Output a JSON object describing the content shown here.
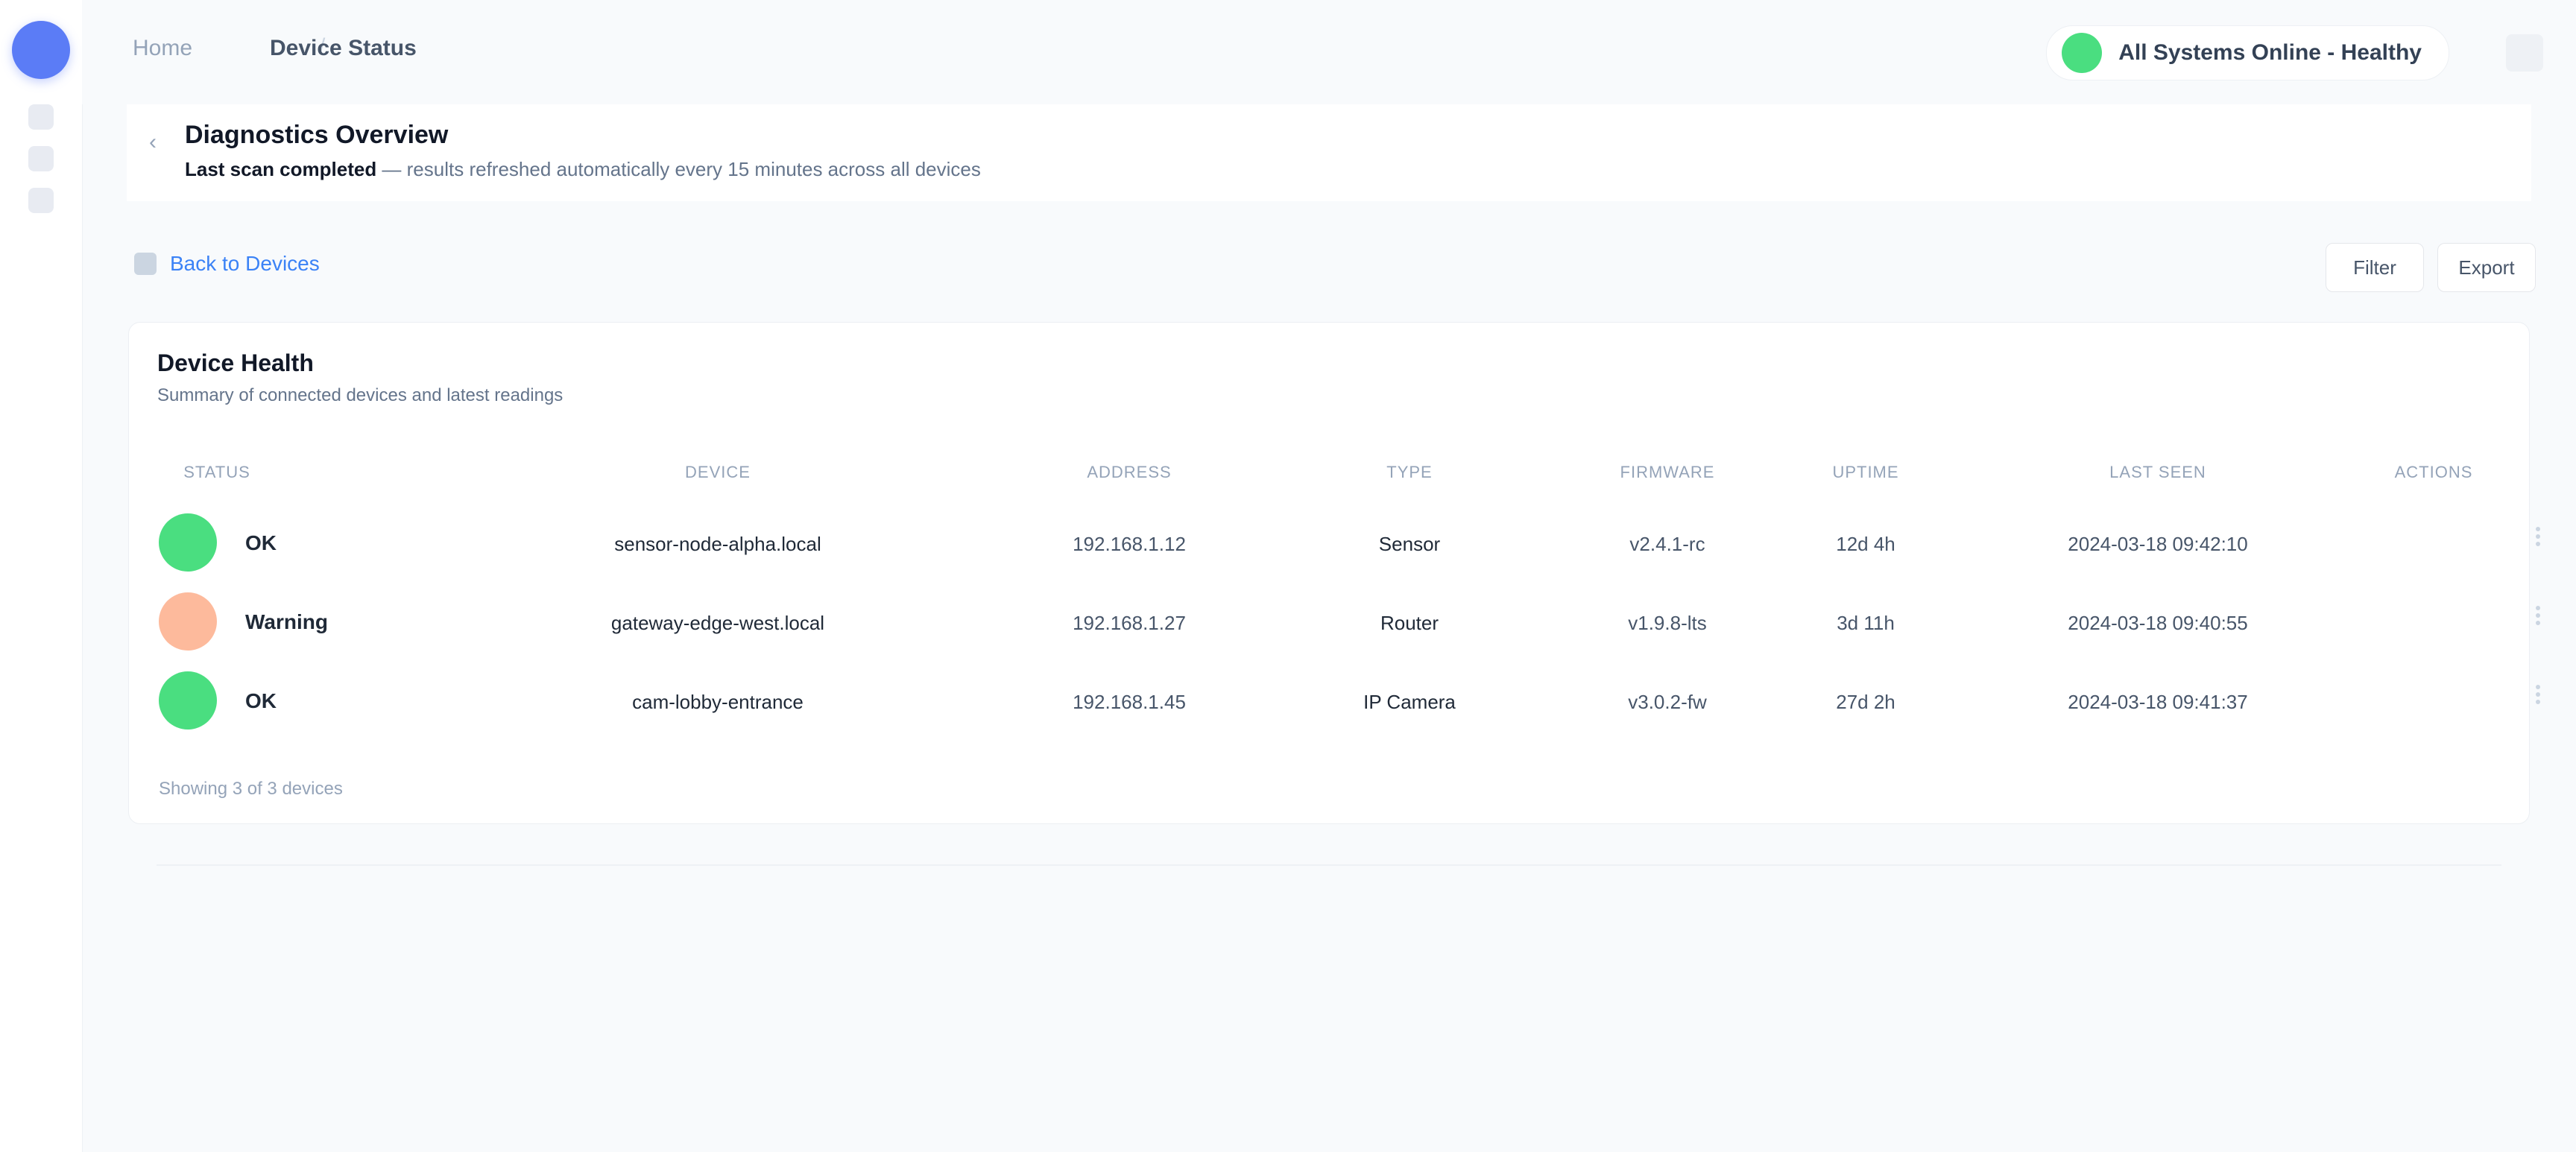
{
  "colors": {
    "accent": "#5b7cf6",
    "success": "#4ade80",
    "warning": "#fdba9c",
    "link": "#3b82f6"
  },
  "rail": {
    "icons": [
      "menu-icon",
      "grid-icon",
      "bell-icon"
    ]
  },
  "breadcrumb": {
    "root": "Home",
    "current": "Device Status"
  },
  "status": {
    "label": "All Systems Online - Healthy"
  },
  "page": {
    "title": "Diagnostics Overview",
    "subtitle_lead": "Last scan completed",
    "subtitle_rest": " — results refreshed automatically every 15 minutes across all devices"
  },
  "toolbar": {
    "back_label": "Back to Devices",
    "filter_label": "Filter",
    "export_label": "Export"
  },
  "table": {
    "title": "Device Health",
    "subtitle": "Summary of connected devices and latest readings",
    "headers": [
      "Status",
      "Device",
      "Address",
      "Type",
      "Firmware",
      "Uptime",
      "Last Seen",
      "Actions"
    ],
    "rows": [
      {
        "status": "OK",
        "device": "sensor-node-alpha.local",
        "address": "192.168.1.12",
        "type": "Sensor",
        "firmware": "v2.4.1-rc",
        "uptime": "12d 4h",
        "last_seen": "2024-03-18 09:42:10"
      },
      {
        "status": "Warning",
        "device": "gateway-edge-west.local",
        "address": "192.168.1.27",
        "type": "Router",
        "firmware": "v1.9.8-lts",
        "uptime": "3d 11h",
        "last_seen": "2024-03-18 09:40:55"
      },
      {
        "status": "OK",
        "device": "cam-lobby-entrance",
        "address": "192.168.1.45",
        "type": "IP Camera",
        "firmware": "v3.0.2-fw",
        "uptime": "27d 2h",
        "last_seen": "2024-03-18 09:41:37"
      }
    ],
    "footer": "Showing 3 of 3 devices"
  }
}
